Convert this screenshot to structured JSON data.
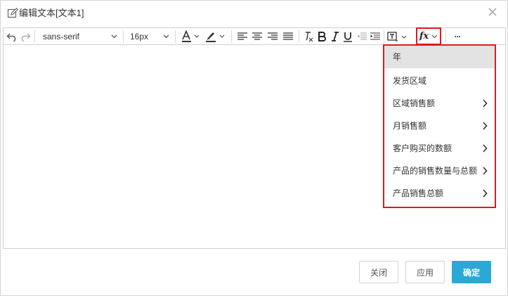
{
  "window": {
    "title": "编辑文本[文本1]"
  },
  "toolbar": {
    "font_family": "sans-serif",
    "font_size": "16px",
    "fx_label": "fx",
    "more_label": "···"
  },
  "menu": {
    "items": [
      {
        "label": "年",
        "submenu": false,
        "active": true
      },
      {
        "label": "发货区域",
        "submenu": false
      },
      {
        "label": "区域销售额",
        "submenu": true
      },
      {
        "label": "月销售额",
        "submenu": true
      },
      {
        "label": "客户购买的数额",
        "submenu": true
      },
      {
        "label": "产品的销售数量与总额",
        "submenu": true
      },
      {
        "label": "产品销售总额",
        "submenu": true
      }
    ]
  },
  "footer": {
    "close_label": "关闭",
    "apply_label": "应用",
    "ok_label": "确定"
  },
  "colors": {
    "accent": "#2aa9d6",
    "highlight_border": "#e0191e"
  }
}
